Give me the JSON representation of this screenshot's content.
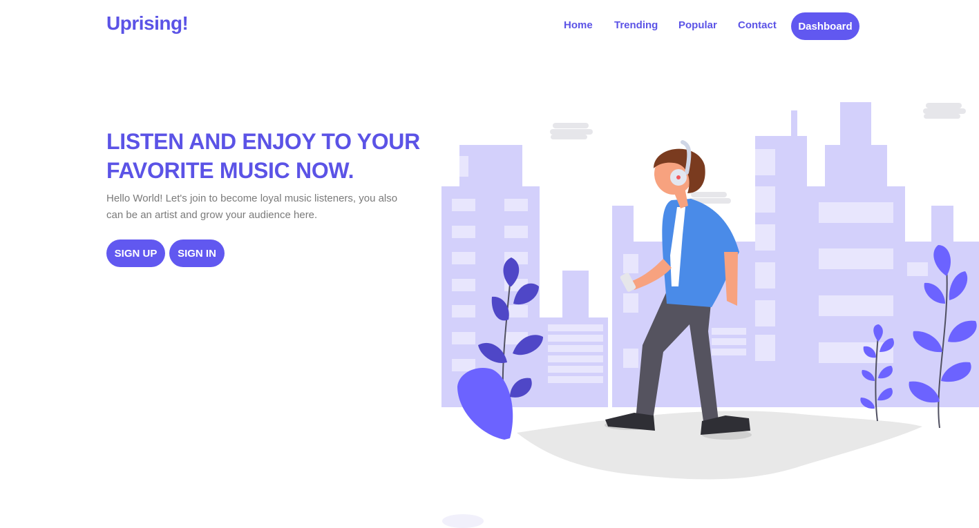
{
  "brand": {
    "name": "Uprising!"
  },
  "nav": {
    "items": [
      {
        "label": "Home"
      },
      {
        "label": "Trending"
      },
      {
        "label": "Popular"
      },
      {
        "label": "Contact"
      }
    ],
    "dashboard_label": "Dashboard"
  },
  "hero": {
    "title_line1": "LISTEN AND ENJOY TO YOUR",
    "title_line2": "FAVORITE MUSIC NOW.",
    "text": "Hello World! Let's join to become loyal music listeners, you also can be an artist and grow your audience here.",
    "signup_label": "SIGN UP",
    "signin_label": "SIGN IN"
  },
  "colors": {
    "accent": "#6158f0",
    "title": "#5b53e6",
    "buildings": "#d3d0fb",
    "leaves_dark": "#4f47c7",
    "leaves_light": "#6c63ff",
    "shirt": "#4a8be8",
    "pants": "#55535f",
    "hair": "#7a3b1f"
  },
  "illustration": {
    "name": "person-listening-music-illustration"
  }
}
